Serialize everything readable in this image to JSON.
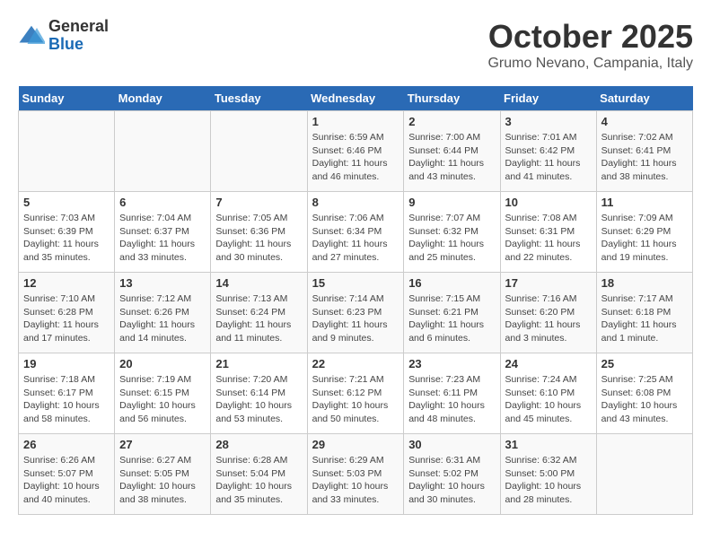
{
  "header": {
    "logo_general": "General",
    "logo_blue": "Blue",
    "title": "October 2025",
    "subtitle": "Grumo Nevano, Campania, Italy"
  },
  "days_of_week": [
    "Sunday",
    "Monday",
    "Tuesday",
    "Wednesday",
    "Thursday",
    "Friday",
    "Saturday"
  ],
  "weeks": [
    [
      {
        "day": "",
        "info": ""
      },
      {
        "day": "",
        "info": ""
      },
      {
        "day": "",
        "info": ""
      },
      {
        "day": "1",
        "info": "Sunrise: 6:59 AM\nSunset: 6:46 PM\nDaylight: 11 hours and 46 minutes."
      },
      {
        "day": "2",
        "info": "Sunrise: 7:00 AM\nSunset: 6:44 PM\nDaylight: 11 hours and 43 minutes."
      },
      {
        "day": "3",
        "info": "Sunrise: 7:01 AM\nSunset: 6:42 PM\nDaylight: 11 hours and 41 minutes."
      },
      {
        "day": "4",
        "info": "Sunrise: 7:02 AM\nSunset: 6:41 PM\nDaylight: 11 hours and 38 minutes."
      }
    ],
    [
      {
        "day": "5",
        "info": "Sunrise: 7:03 AM\nSunset: 6:39 PM\nDaylight: 11 hours and 35 minutes."
      },
      {
        "day": "6",
        "info": "Sunrise: 7:04 AM\nSunset: 6:37 PM\nDaylight: 11 hours and 33 minutes."
      },
      {
        "day": "7",
        "info": "Sunrise: 7:05 AM\nSunset: 6:36 PM\nDaylight: 11 hours and 30 minutes."
      },
      {
        "day": "8",
        "info": "Sunrise: 7:06 AM\nSunset: 6:34 PM\nDaylight: 11 hours and 27 minutes."
      },
      {
        "day": "9",
        "info": "Sunrise: 7:07 AM\nSunset: 6:32 PM\nDaylight: 11 hours and 25 minutes."
      },
      {
        "day": "10",
        "info": "Sunrise: 7:08 AM\nSunset: 6:31 PM\nDaylight: 11 hours and 22 minutes."
      },
      {
        "day": "11",
        "info": "Sunrise: 7:09 AM\nSunset: 6:29 PM\nDaylight: 11 hours and 19 minutes."
      }
    ],
    [
      {
        "day": "12",
        "info": "Sunrise: 7:10 AM\nSunset: 6:28 PM\nDaylight: 11 hours and 17 minutes."
      },
      {
        "day": "13",
        "info": "Sunrise: 7:12 AM\nSunset: 6:26 PM\nDaylight: 11 hours and 14 minutes."
      },
      {
        "day": "14",
        "info": "Sunrise: 7:13 AM\nSunset: 6:24 PM\nDaylight: 11 hours and 11 minutes."
      },
      {
        "day": "15",
        "info": "Sunrise: 7:14 AM\nSunset: 6:23 PM\nDaylight: 11 hours and 9 minutes."
      },
      {
        "day": "16",
        "info": "Sunrise: 7:15 AM\nSunset: 6:21 PM\nDaylight: 11 hours and 6 minutes."
      },
      {
        "day": "17",
        "info": "Sunrise: 7:16 AM\nSunset: 6:20 PM\nDaylight: 11 hours and 3 minutes."
      },
      {
        "day": "18",
        "info": "Sunrise: 7:17 AM\nSunset: 6:18 PM\nDaylight: 11 hours and 1 minute."
      }
    ],
    [
      {
        "day": "19",
        "info": "Sunrise: 7:18 AM\nSunset: 6:17 PM\nDaylight: 10 hours and 58 minutes."
      },
      {
        "day": "20",
        "info": "Sunrise: 7:19 AM\nSunset: 6:15 PM\nDaylight: 10 hours and 56 minutes."
      },
      {
        "day": "21",
        "info": "Sunrise: 7:20 AM\nSunset: 6:14 PM\nDaylight: 10 hours and 53 minutes."
      },
      {
        "day": "22",
        "info": "Sunrise: 7:21 AM\nSunset: 6:12 PM\nDaylight: 10 hours and 50 minutes."
      },
      {
        "day": "23",
        "info": "Sunrise: 7:23 AM\nSunset: 6:11 PM\nDaylight: 10 hours and 48 minutes."
      },
      {
        "day": "24",
        "info": "Sunrise: 7:24 AM\nSunset: 6:10 PM\nDaylight: 10 hours and 45 minutes."
      },
      {
        "day": "25",
        "info": "Sunrise: 7:25 AM\nSunset: 6:08 PM\nDaylight: 10 hours and 43 minutes."
      }
    ],
    [
      {
        "day": "26",
        "info": "Sunrise: 6:26 AM\nSunset: 5:07 PM\nDaylight: 10 hours and 40 minutes."
      },
      {
        "day": "27",
        "info": "Sunrise: 6:27 AM\nSunset: 5:05 PM\nDaylight: 10 hours and 38 minutes."
      },
      {
        "day": "28",
        "info": "Sunrise: 6:28 AM\nSunset: 5:04 PM\nDaylight: 10 hours and 35 minutes."
      },
      {
        "day": "29",
        "info": "Sunrise: 6:29 AM\nSunset: 5:03 PM\nDaylight: 10 hours and 33 minutes."
      },
      {
        "day": "30",
        "info": "Sunrise: 6:31 AM\nSunset: 5:02 PM\nDaylight: 10 hours and 30 minutes."
      },
      {
        "day": "31",
        "info": "Sunrise: 6:32 AM\nSunset: 5:00 PM\nDaylight: 10 hours and 28 minutes."
      },
      {
        "day": "",
        "info": ""
      }
    ]
  ]
}
